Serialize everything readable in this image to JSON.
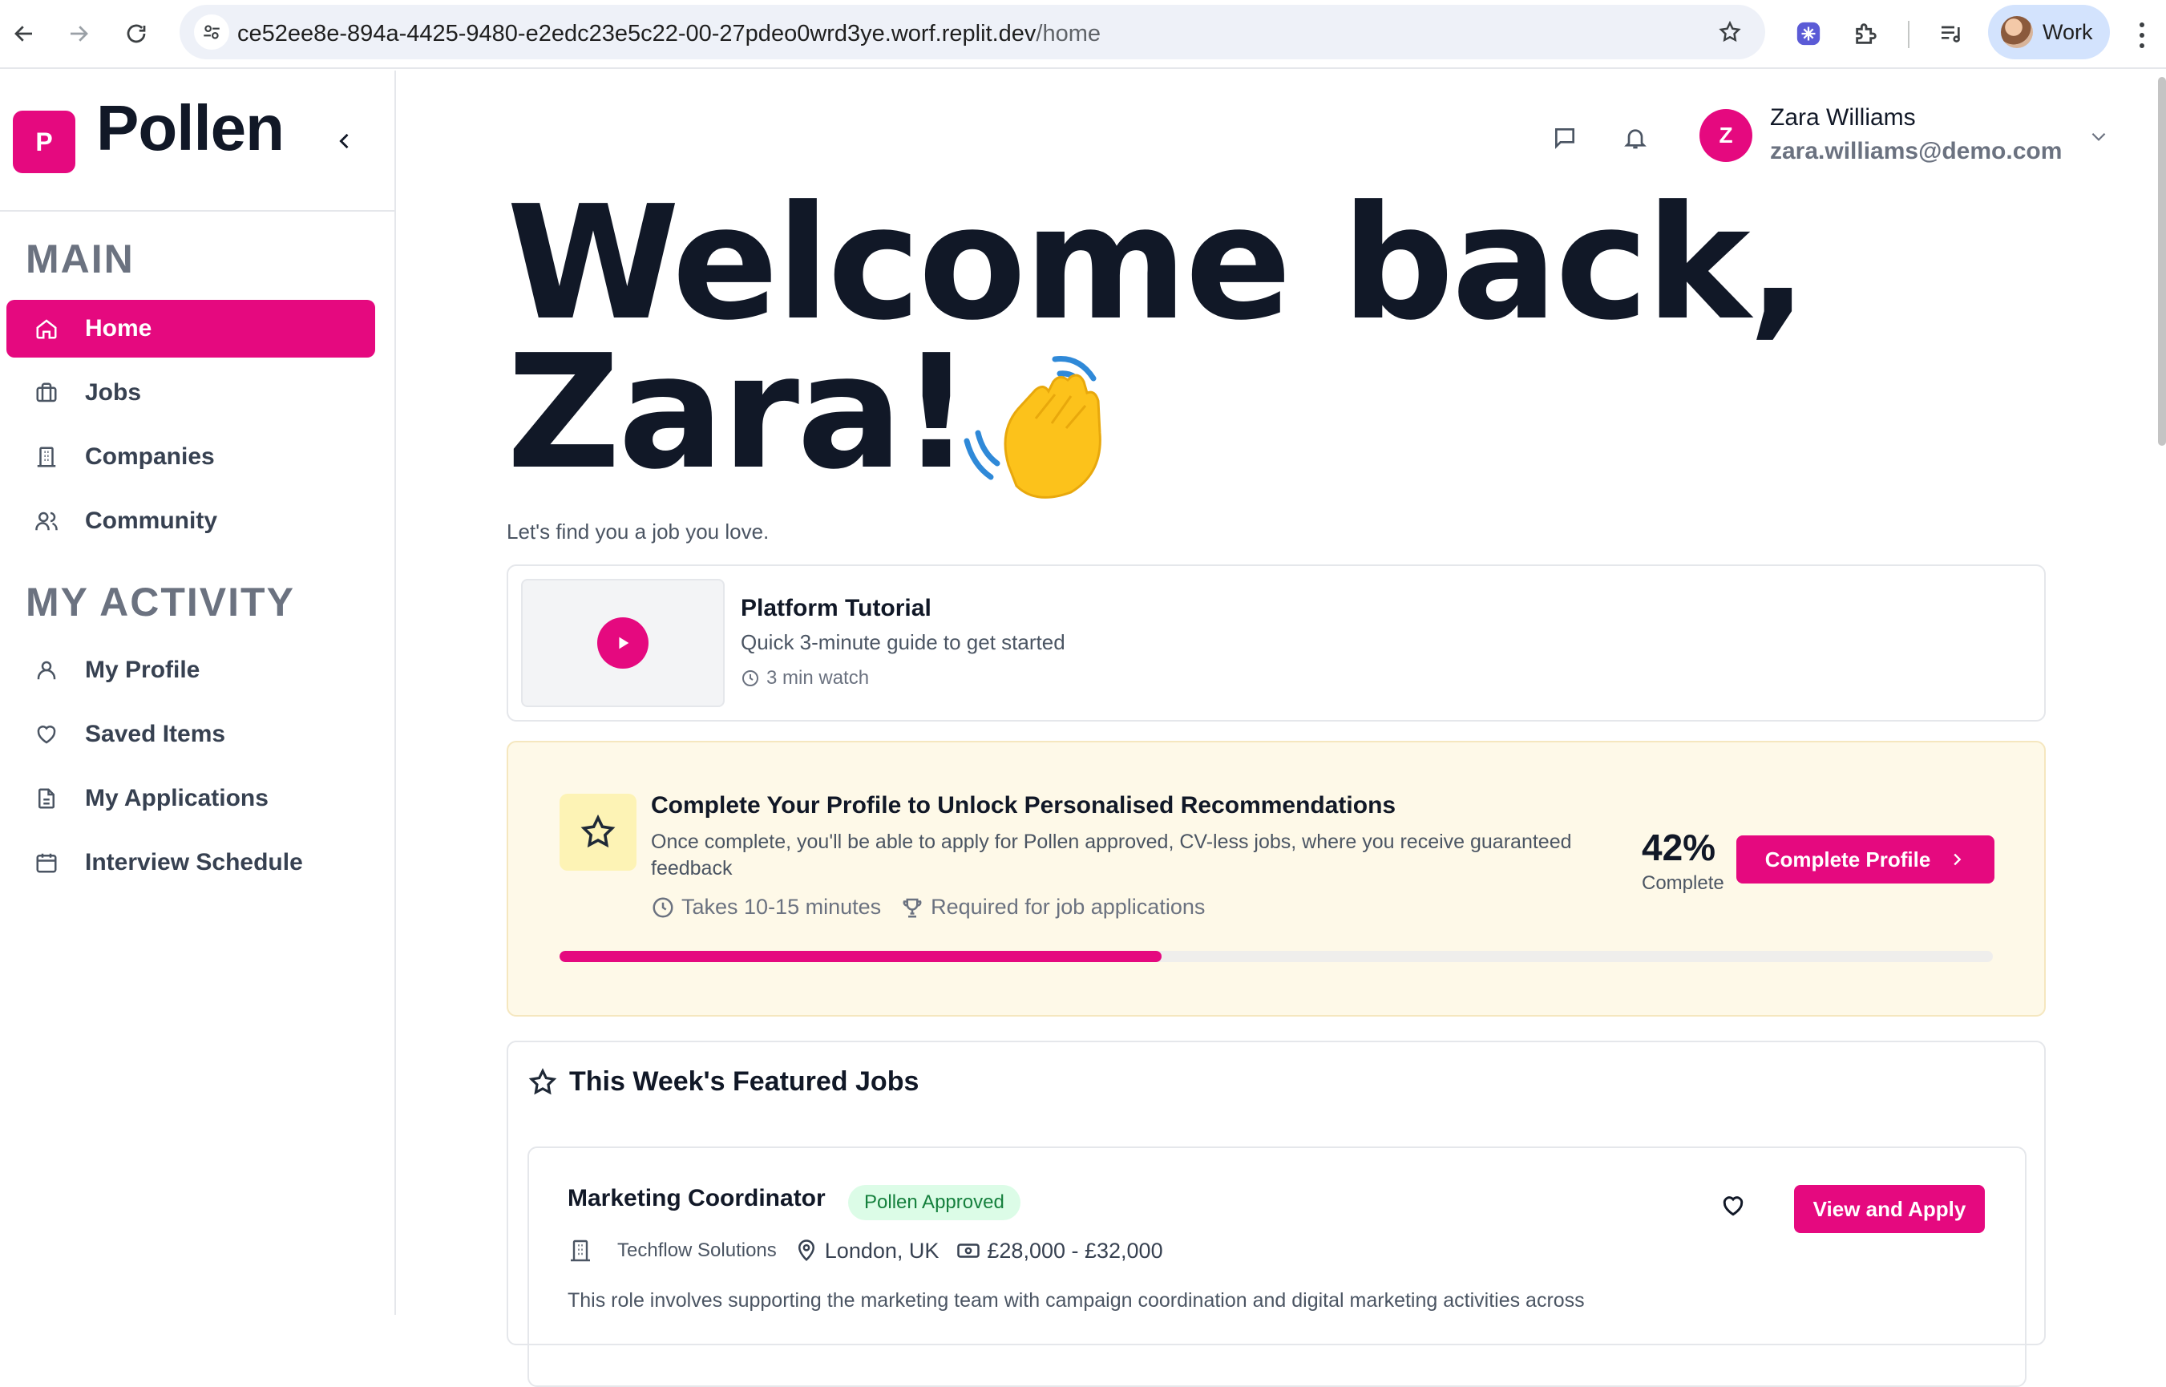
{
  "browser": {
    "url_host": "ce52ee8e-894a-4425-9480-e2edc23e5c22-00-27pdeo0wrd3ye.worf.replit.dev",
    "url_path": "/home",
    "profile_label": "Work"
  },
  "sidebar": {
    "logo_letter": "P",
    "brand": "Pollen",
    "main_title": "MAIN",
    "main_items": [
      {
        "label": "Home",
        "icon": "home-icon"
      },
      {
        "label": "Jobs",
        "icon": "briefcase-icon"
      },
      {
        "label": "Companies",
        "icon": "building-icon"
      },
      {
        "label": "Community",
        "icon": "users-icon"
      }
    ],
    "activity_title": "MY ACTIVITY",
    "activity_items": [
      {
        "label": "My Profile",
        "icon": "user-icon"
      },
      {
        "label": "Saved Items",
        "icon": "heart-icon"
      },
      {
        "label": "My Applications",
        "icon": "document-icon"
      },
      {
        "label": "Interview Schedule",
        "icon": "calendar-icon"
      }
    ]
  },
  "user": {
    "initial": "Z",
    "name": "Zara Williams",
    "email": "zara.williams@demo.com"
  },
  "hero": {
    "line1": "Welcome back,",
    "line2": "Zara!",
    "subtitle": "Let's find you a job you love."
  },
  "tutorial": {
    "title": "Platform Tutorial",
    "description": "Quick 3-minute guide to get started",
    "duration": "3 min watch"
  },
  "profile_prompt": {
    "title": "Complete Your Profile to Unlock Personalised Recommendations",
    "description": "Once complete, you'll be able to apply for Pollen approved, CV-less jobs, where you receive guaranteed feedback",
    "time": "Takes 10-15 minutes",
    "requirement": "Required for job applications",
    "percent_label": "42%",
    "percent_caption": "Complete",
    "progress": 0.42,
    "button": "Complete Profile"
  },
  "featured": {
    "title": "This Week's Featured Jobs",
    "jobs": [
      {
        "title": "Marketing Coordinator",
        "badge": "Pollen Approved",
        "company": "Techflow Solutions",
        "location": "London, UK",
        "salary": "£28,000 - £32,000",
        "description": "This role involves supporting the marketing team with campaign coordination and digital marketing activities across",
        "button": "View and Apply"
      }
    ]
  },
  "colors": {
    "brand": "#e5097f",
    "badge_bg": "#dcfce7",
    "badge_text": "#15803d",
    "prompt_bg": "#fef9e8"
  }
}
